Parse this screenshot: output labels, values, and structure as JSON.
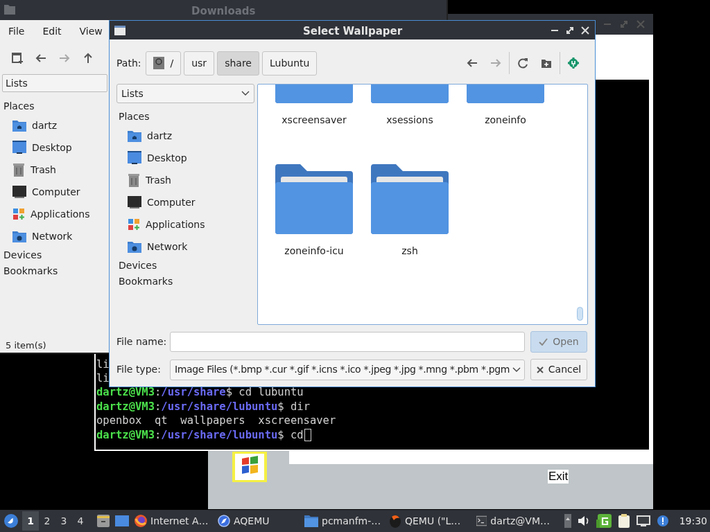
{
  "guest_window": {
    "exit_label": "Exit"
  },
  "terminal": {
    "lines": [
      {
        "kind": "output",
        "text": "li"
      },
      {
        "kind": "output",
        "text": "li"
      },
      {
        "kind": "prompt",
        "user": "dartz@VM3",
        "separator": ":",
        "path": "/usr/share",
        "command": "$ cd lubuntu",
        "cursor": false
      },
      {
        "kind": "prompt",
        "user": "dartz@VM3",
        "separator": ":",
        "path": "/usr/share/lubuntu",
        "command": "$ dir",
        "cursor": false
      },
      {
        "kind": "output",
        "text": "openbox  qt  wallpapers  xscreensaver"
      },
      {
        "kind": "prompt",
        "user": "dartz@VM3",
        "separator": ":",
        "path": "/usr/share/lubuntu",
        "command": "$ cd",
        "cursor": true
      }
    ]
  },
  "file_manager": {
    "title": "Downloads",
    "menu": [
      "File",
      "Edit",
      "View"
    ],
    "toolbar": [
      {
        "kind": "new-tab",
        "disabled": false
      },
      {
        "kind": "back",
        "disabled": false
      },
      {
        "kind": "forward",
        "disabled": true
      },
      {
        "kind": "up",
        "disabled": false
      }
    ],
    "side_pane_mode": "Lists",
    "places_header": "Places",
    "places": [
      {
        "label": "dartz",
        "kind": "home"
      },
      {
        "label": "Desktop",
        "kind": "desktop"
      },
      {
        "label": "Trash",
        "kind": "trash"
      },
      {
        "label": "Computer",
        "kind": "computer"
      },
      {
        "label": "Applications",
        "kind": "applications"
      },
      {
        "label": "Network",
        "kind": "network"
      }
    ],
    "sections": [
      "Devices",
      "Bookmarks"
    ],
    "status": "5 item(s)"
  },
  "dialog": {
    "title": "Select Wallpaper",
    "path_label": "Path:",
    "path": [
      {
        "label": "/",
        "kind": "root",
        "selected": false
      },
      {
        "label": "usr",
        "kind": "dir",
        "selected": false
      },
      {
        "label": "share",
        "kind": "dir",
        "selected": true
      },
      {
        "label": "Lubuntu",
        "kind": "dir",
        "selected": false
      }
    ],
    "toolbar": [
      {
        "kind": "back",
        "disabled": false
      },
      {
        "kind": "forward",
        "disabled": true
      },
      {
        "kind": "reload",
        "disabled": false
      },
      {
        "kind": "new-folder",
        "disabled": false
      },
      {
        "kind": "settings",
        "disabled": false
      }
    ],
    "side_pane_mode": "Lists",
    "places_header": "Places",
    "places": [
      {
        "label": "dartz",
        "kind": "home"
      },
      {
        "label": "Desktop",
        "kind": "desktop"
      },
      {
        "label": "Trash",
        "kind": "trash"
      },
      {
        "label": "Computer",
        "kind": "computer"
      },
      {
        "label": "Applications",
        "kind": "applications"
      },
      {
        "label": "Network",
        "kind": "network"
      }
    ],
    "sections": [
      "Devices",
      "Bookmarks"
    ],
    "files": [
      {
        "name": "xscreensaver"
      },
      {
        "name": "xsessions"
      },
      {
        "name": "zoneinfo"
      },
      {
        "name": "zoneinfo-icu"
      },
      {
        "name": "zsh"
      }
    ],
    "file_name_label": "File name:",
    "file_type_label": "File type:",
    "file_type": "Image Files (*.bmp *.cur *.gif *.icns *.ico *.jpeg *.jpg *.mng *.pbm *.pgm",
    "buttons": [
      {
        "label": "Open",
        "kind": "open",
        "disabled": true
      },
      {
        "label": "Cancel",
        "kind": "cancel",
        "disabled": false
      }
    ]
  },
  "taskbar": {
    "workspaces": [
      {
        "label": "1",
        "selected": true
      },
      {
        "label": "2",
        "selected": false
      },
      {
        "label": "3",
        "selected": false
      },
      {
        "label": "4",
        "selected": false
      }
    ],
    "tasks": [
      {
        "label": "Internet A…",
        "kind": "browser"
      },
      {
        "label": "AQEMU",
        "kind": "emulator"
      },
      {
        "label": "pcmanfm-…",
        "kind": "folder"
      },
      {
        "label": "QEMU (\"L…",
        "kind": "qemu"
      },
      {
        "label": "dartz@VM…",
        "kind": "terminal"
      }
    ],
    "clock": "19:30"
  }
}
